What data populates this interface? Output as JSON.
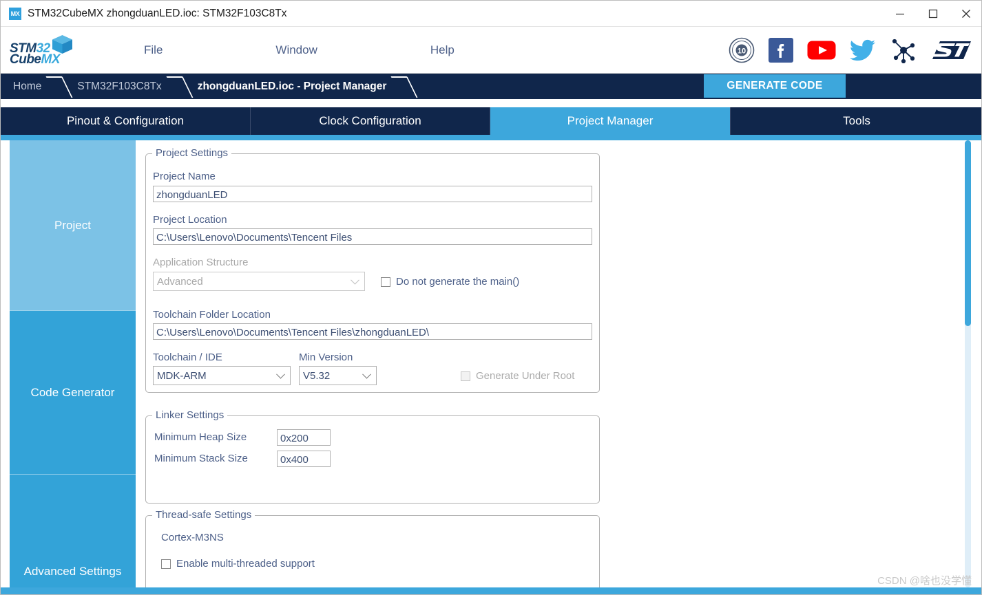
{
  "window": {
    "title": "STM32CubeMX zhongduanLED.ioc: STM32F103C8Tx",
    "icon_label": "MX",
    "minimize_icon": "minimize-icon",
    "maximize_icon": "maximize-icon",
    "close_icon": "close-icon"
  },
  "logo": {
    "line1_dark": "STM",
    "line1_light": "32",
    "line2_dark": "Cube",
    "line2_light": "MX"
  },
  "menu": {
    "items": [
      {
        "label": "File"
      },
      {
        "label": "Window"
      },
      {
        "label": "Help"
      }
    ]
  },
  "social": {
    "items": [
      {
        "name": "ten-years-badge-icon",
        "label": "10"
      },
      {
        "name": "facebook-icon",
        "label": "f"
      },
      {
        "name": "youtube-icon",
        "label": "YouTube"
      },
      {
        "name": "twitter-icon",
        "label": "Twitter"
      },
      {
        "name": "community-network-icon",
        "label": "Community"
      },
      {
        "name": "st-logo-icon",
        "label": "ST"
      }
    ]
  },
  "breadcrumb": {
    "items": [
      {
        "label": "Home",
        "active": false
      },
      {
        "label": "STM32F103C8Tx",
        "active": false
      },
      {
        "label": "zhongduanLED.ioc - Project Manager",
        "active": true
      }
    ]
  },
  "generate_code_button": "GENERATE CODE",
  "tabs": [
    {
      "label": "Pinout & Configuration",
      "active": false
    },
    {
      "label": "Clock Configuration",
      "active": false
    },
    {
      "label": "Project Manager",
      "active": true
    },
    {
      "label": "Tools",
      "active": false
    }
  ],
  "sidebar": {
    "items": [
      {
        "label": "Project",
        "selected": true
      },
      {
        "label": "Code Generator",
        "selected": false
      },
      {
        "label": "Advanced Settings",
        "selected": false
      }
    ]
  },
  "project_settings": {
    "legend": "Project Settings",
    "project_name_label": "Project Name",
    "project_name_value": "zhongduanLED",
    "project_location_label": "Project Location",
    "project_location_value": "C:\\Users\\Lenovo\\Documents\\Tencent Files",
    "application_structure_label": "Application Structure",
    "application_structure_value": "Advanced",
    "do_not_generate_main_label": "Do not generate the main()",
    "toolchain_folder_label": "Toolchain Folder Location",
    "toolchain_folder_value": "C:\\Users\\Lenovo\\Documents\\Tencent Files\\zhongduanLED\\",
    "toolchain_ide_label": "Toolchain / IDE",
    "toolchain_ide_value": "MDK-ARM",
    "min_version_label": "Min Version",
    "min_version_value": "V5.32",
    "generate_under_root_label": "Generate Under Root"
  },
  "linker_settings": {
    "legend": "Linker Settings",
    "min_heap_label": "Minimum Heap Size",
    "min_heap_value": "0x200",
    "min_stack_label": "Minimum Stack Size",
    "min_stack_value": "0x400"
  },
  "thread_safe_settings": {
    "legend": "Thread-safe Settings",
    "core_label": "Cortex-M3NS",
    "enable_multithread_label": "Enable multi-threaded support"
  },
  "watermark": "CSDN @啥也没学懂",
  "colors": {
    "navy": "#10264b",
    "accent_blue": "#3da7dc",
    "sidebar_selected": "#7cc2e6",
    "sidebar_normal": "#33a3d8",
    "label_text": "#4c5f88"
  }
}
